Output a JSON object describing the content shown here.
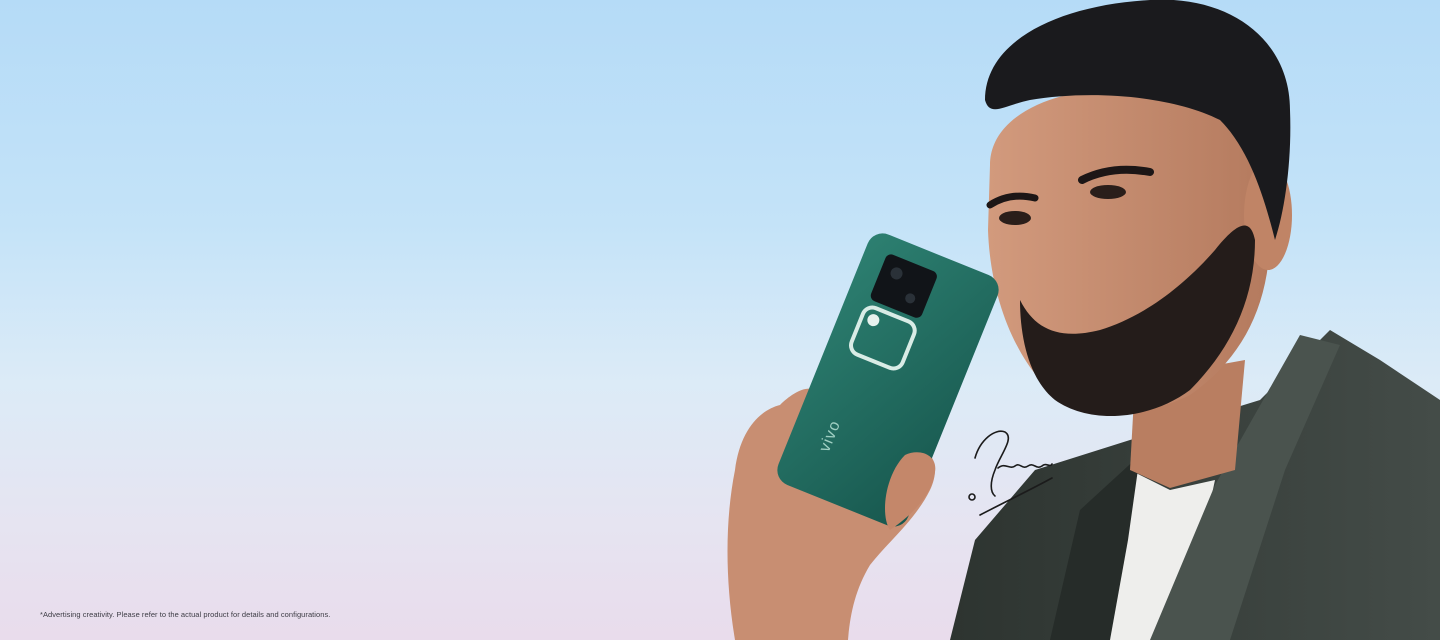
{
  "banner": {
    "phone_logo": "vivo",
    "signature_text": "Tahsan",
    "disclaimer": "*Advertising creativity. Please refer to the actual product for details and configurations."
  },
  "colors": {
    "sky_top": "#b5dbf7",
    "sky_bottom": "#e9dcec",
    "phone_green": "#1f6a5f",
    "jacket": "#3b433f",
    "tshirt": "#eeeeec",
    "hair": "#1a1a1d"
  }
}
